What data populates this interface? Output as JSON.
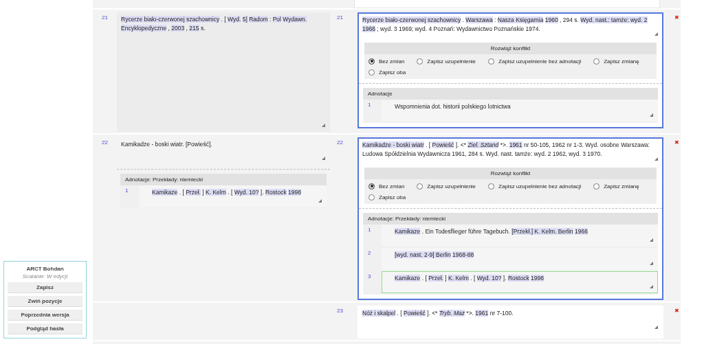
{
  "sidebar": {
    "title": "ARCT Bohdan",
    "subtitle": "Scalanie: W edycji",
    "buttons": [
      "Zapisz",
      "Zwiń pozycje",
      "Poprzednia wersja",
      "Podgląd hasła"
    ]
  },
  "entries": [
    {
      "selected": true,
      "delete": "✖",
      "left": {
        "number": "21",
        "segments": [
          {
            "text": "Rycerze biało-czerwonej szachownicy",
            "marked": true
          },
          {
            "text": ". [",
            "marked": false
          },
          {
            "text": "Wyd.",
            "marked": true
          },
          {
            "text": "5]",
            "marked": true
          },
          {
            "text": "Radom",
            "marked": true
          },
          {
            "text": ":",
            "marked": false
          },
          {
            "text": "Pol",
            "marked": true
          },
          {
            "text": "Wydawn. Encyklopedyczne",
            "marked": true
          },
          {
            "text": ",",
            "marked": false
          },
          {
            "text": "2003",
            "marked": true
          },
          {
            "text": ",",
            "marked": false
          },
          {
            "text": "215",
            "marked": true
          },
          {
            "text": "s.",
            "marked": false
          }
        ]
      },
      "right": {
        "number": "21",
        "segments": [
          {
            "text": "Rycerze biało-czerwonej szachownicy",
            "marked": true
          },
          {
            "text": ".",
            "marked": false
          },
          {
            "text": "Warszawa",
            "marked": true
          },
          {
            "text": ":",
            "marked": false
          },
          {
            "text": "Nasza Księgarnia",
            "marked": true
          },
          {
            "text": "1960",
            "marked": true
          },
          {
            "text": ", 294 s.",
            "marked": false
          },
          {
            "text": "Wyd. nast.: tamże: wyd. 2 1966",
            "marked": true
          },
          {
            "text": "; wyd. 3 1969; wyd. 4 Poznań: Wydawnictwo Poznańskie 1974.",
            "marked": false
          }
        ],
        "conflict": {
          "title": "Rozwiąż konflikt",
          "options": [
            {
              "label": "Bez zmian",
              "selected": true
            },
            {
              "label": "Zapisz uzupełnienie",
              "selected": false
            },
            {
              "label": "Zapisz uzupełnienie bez adnotacji",
              "selected": false
            },
            {
              "label": "Zapisz zmianę",
              "selected": false
            },
            {
              "label": "Zapisz oba",
              "selected": false
            }
          ]
        },
        "annotations": {
          "title": "Adnotacje",
          "items": [
            {
              "number": "1",
              "selected": false,
              "segments": [
                {
                  "text": "Wspomnienia dot. historii polskiego lotnictwa",
                  "marked": false
                }
              ]
            }
          ]
        }
      }
    },
    {
      "selected": true,
      "delete": "✖",
      "left": {
        "number": "22",
        "segments": [
          {
            "text": "Kamikadze - boski wiatr. [Powieść].",
            "marked": false
          }
        ],
        "annotations": {
          "title": "Adnotacje: Przekłady: niemiecki",
          "items": [
            {
              "number": "1",
              "selected": false,
              "segments": [
                {
                  "text": "Kamikaze",
                  "marked": true
                },
                {
                  "text": ". [",
                  "marked": false
                },
                {
                  "text": "Przeł.",
                  "marked": true
                },
                {
                  "text": "]",
                  "marked": false
                },
                {
                  "text": "K. Kelm",
                  "marked": true
                },
                {
                  "text": ". [",
                  "marked": false
                },
                {
                  "text": "Wyd. 10?",
                  "marked": true
                },
                {
                  "text": "].",
                  "marked": false
                },
                {
                  "text": "Rostock",
                  "marked": true
                },
                {
                  "text": "1998",
                  "marked": true
                }
              ]
            }
          ]
        }
      },
      "right": {
        "number": "22",
        "segments": [
          {
            "text": "Kamikadze - boski wiatr",
            "marked": true
          },
          {
            "text": ". [",
            "marked": false
          },
          {
            "text": "Powieść",
            "marked": true
          },
          {
            "text": "]. <*",
            "marked": false
          },
          {
            "text": "*Ziel. Sztand*",
            "marked": true
          },
          {
            "text": "*>.",
            "marked": false
          },
          {
            "text": "1961",
            "marked": true
          },
          {
            "text": "nr 50-105, 1962 nr 1-3. Wyd. osobne Warszawa: Ludowa Spółdzielnia Wydawnicza 1961, 284 s. Wyd. nast. tamże: wyd. 2 1962, wyd. 3 1970.",
            "marked": false
          }
        ],
        "conflict": {
          "title": "Rozwiąż konflikt",
          "options": [
            {
              "label": "Bez zmian",
              "selected": true
            },
            {
              "label": "Zapisz uzupełnienie",
              "selected": false
            },
            {
              "label": "Zapisz uzupełnienie bez adnotacji",
              "selected": false
            },
            {
              "label": "Zapisz zmianę",
              "selected": false
            },
            {
              "label": "Zapisz oba",
              "selected": false
            }
          ]
        },
        "annotations": {
          "title": "Adnotacje: Przekłady: niemiecki",
          "items": [
            {
              "number": "1",
              "selected": false,
              "segments": [
                {
                  "text": "Kamikaze",
                  "marked": true
                },
                {
                  "text": ". Ein Todesflieger führe Tagebuch.",
                  "marked": false
                },
                {
                  "text": "[Przekł.] K. Kelm. Berlin",
                  "marked": true
                },
                {
                  "text": "1966",
                  "marked": true
                }
              ]
            },
            {
              "number": "2",
              "selected": false,
              "segments": [
                {
                  "text": "[wyd. nast. 2-9] Berlin",
                  "marked": true
                },
                {
                  "text": "1968-88",
                  "marked": true
                }
              ]
            },
            {
              "number": "3",
              "selected": true,
              "segments": [
                {
                  "text": "Kamikaze",
                  "marked": true
                },
                {
                  "text": ". [",
                  "marked": false
                },
                {
                  "text": "Przeł.",
                  "marked": true
                },
                {
                  "text": "]",
                  "marked": false
                },
                {
                  "text": "K. Kelm",
                  "marked": true
                },
                {
                  "text": ". [",
                  "marked": false
                },
                {
                  "text": "Wyd. 10?",
                  "marked": true
                },
                {
                  "text": "].",
                  "marked": false
                },
                {
                  "text": "Rostock",
                  "marked": true
                },
                {
                  "text": "1998",
                  "marked": true
                }
              ]
            }
          ]
        }
      }
    },
    {
      "selected": false,
      "delete": "✖",
      "right": {
        "number": "23",
        "segments": [
          {
            "text": "Nóż i skalpel",
            "marked": true
          },
          {
            "text": ". [",
            "marked": false
          },
          {
            "text": "Powieść",
            "marked": true
          },
          {
            "text": "]. <*",
            "marked": false
          },
          {
            "text": "*Tryb. Maz*",
            "marked": true
          },
          {
            "text": "*>.",
            "marked": false
          },
          {
            "text": "1961",
            "marked": true
          },
          {
            "text": "nr 7-100.",
            "marked": false
          }
        ]
      }
    }
  ]
}
